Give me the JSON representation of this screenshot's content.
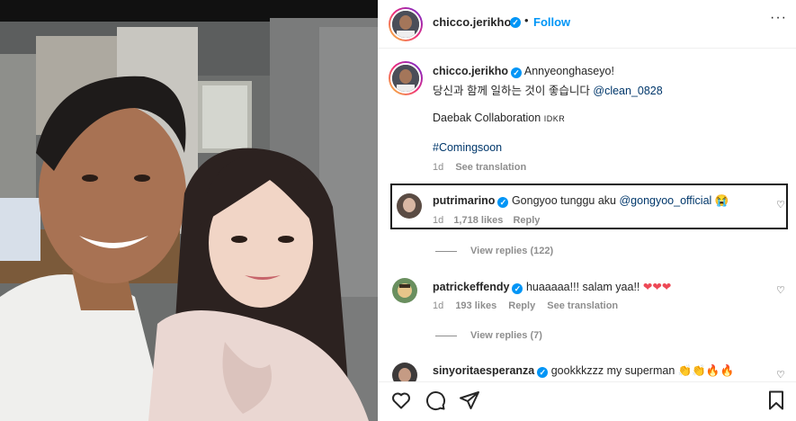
{
  "header": {
    "username": "chicco.jerikho",
    "separator": "•",
    "follow_label": "Follow",
    "more_label": "···"
  },
  "caption": {
    "username": "chicco.jerikho",
    "line1": "Annyeonghaseyo!",
    "line2_text": "당신과 함께 일하는 것이 좋습니다 ",
    "line2_mention": "@clean_0828",
    "line3_text": "Daebak Collaboration ",
    "line3_flag": "IDKR",
    "hashtag": "#Comingsoon",
    "time": "1d",
    "see_translation": "See translation"
  },
  "comments": [
    {
      "username": "putrimarino",
      "text": "Gongyoo tunggu aku ",
      "mention": "@gongyoo_official",
      "emoji": "😭",
      "time": "1d",
      "likes": "1,718 likes",
      "reply": "Reply",
      "view_replies": "View replies (122)"
    },
    {
      "username": "patrickeffendy",
      "text": "huaaaaa!!! salam yaa!! ",
      "emoji": "❤❤❤",
      "time": "1d",
      "likes": "193 likes",
      "reply": "Reply",
      "see_translation": "See translation",
      "view_replies": "View replies (7)"
    },
    {
      "username": "sinyoritaesperanza",
      "text": "gookkkzzz my superman ",
      "emoji": "👏👏🔥🔥"
    }
  ],
  "icons": {
    "heart": "heart-icon",
    "comment": "comment-icon",
    "share": "share-icon",
    "save": "bookmark-icon"
  },
  "colors": {
    "accent": "#0095f6",
    "link": "#00376b",
    "muted": "#8e8e8e",
    "heart_red": "#ed4956"
  }
}
